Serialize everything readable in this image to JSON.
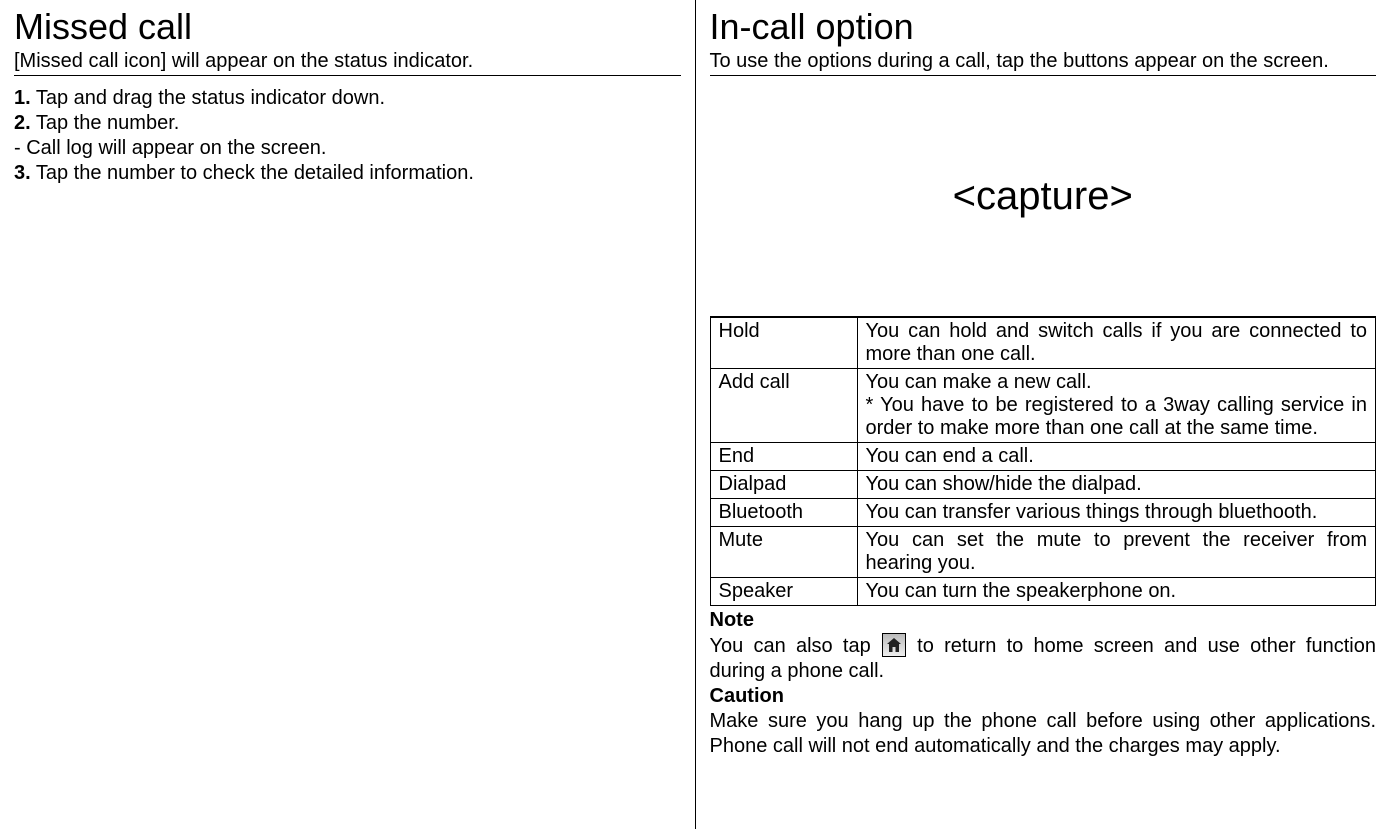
{
  "left": {
    "title": "Missed call",
    "subdesc": "[Missed call icon] will appear on the status indicator.",
    "step1_num": "1.",
    "step1": " Tap and drag the status indicator down.",
    "step2_num": "2.",
    "step2": " Tap the number.",
    "step2_sub": "- Call log will appear on the screen.",
    "step3_num": "3.",
    "step3": " Tap the number to check the detailed information."
  },
  "right": {
    "title": "In-call option",
    "subdesc": "To use the options during a call, tap the buttons appear on the screen.",
    "capture": "<capture>",
    "table": [
      {
        "label": "Hold",
        "desc": "You can hold and switch calls if you are connected to more than one call."
      },
      {
        "label": "Add call",
        "desc": "You can make a new call.\n* You have to be registered to a 3way calling service in order to make more than one call at the same time."
      },
      {
        "label": "End",
        "desc": "You can end a call."
      },
      {
        "label": "Dialpad",
        "desc": "You can show/hide the dialpad."
      },
      {
        "label": "Bluetooth",
        "desc": "You can transfer various things through bluethooth."
      },
      {
        "label": "Mute",
        "desc": "You can set the mute to prevent the receiver from hearing you."
      },
      {
        "label": "Speaker",
        "desc": "You can turn the speakerphone on."
      }
    ],
    "note_label": "Note",
    "note_text_a": "You can also tap ",
    "note_text_b": " to return to home screen and use other function during a phone call.",
    "caution_label": "Caution",
    "caution_text": "Make sure you hang up the phone call before using other applications. Phone call will not end automatically and the charges may apply."
  }
}
